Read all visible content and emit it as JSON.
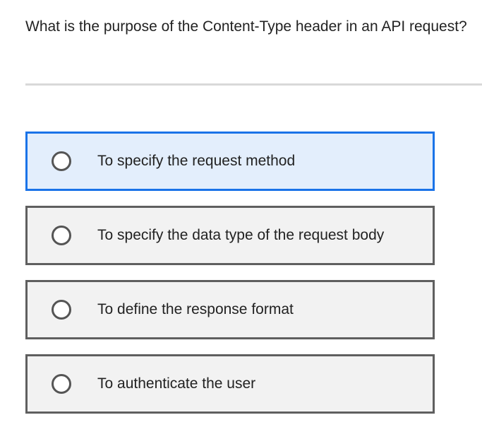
{
  "question": {
    "text": "What is the purpose of the Content-Type header in an API request?"
  },
  "options": [
    {
      "label": "To specify the request method",
      "state": "hovered",
      "checked": false
    },
    {
      "label": "To specify the data type of the request body",
      "state": "default",
      "checked": false
    },
    {
      "label": "To define the response format",
      "state": "default",
      "checked": false
    },
    {
      "label": "To authenticate the user",
      "state": "default",
      "checked": false
    }
  ],
  "colors": {
    "highlight_border": "#1a73e8",
    "highlight_fill": "#e3eefc",
    "option_border": "#5f5f5f",
    "option_fill": "#f2f2f2",
    "divider": "#d9d9d9"
  }
}
